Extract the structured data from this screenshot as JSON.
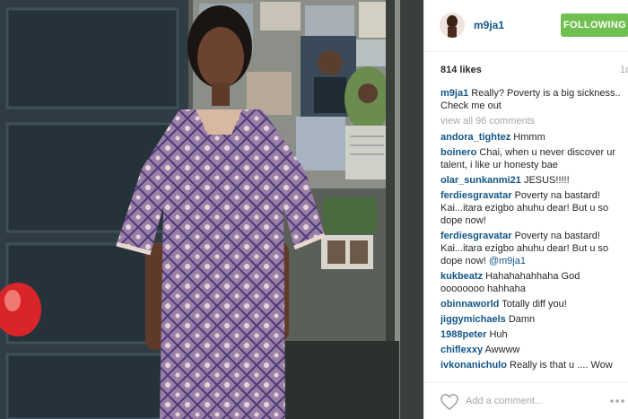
{
  "post": {
    "username": "m9ja1",
    "follow_label": "FOLLOWING",
    "likes": "814 likes",
    "time": "1d",
    "caption_user": "m9ja1",
    "caption_text": "Really? Poverty is a big sickness.. Check me out",
    "view_all": "view all 96 comments"
  },
  "comments": [
    {
      "user": "andora_tightez",
      "text": "Hmmm"
    },
    {
      "user": "boinero",
      "text": "Chai, when u never discover ur talent, i like ur honesty bae"
    },
    {
      "user": "olar_sunkanmi21",
      "text": "JESUS!!!!!"
    },
    {
      "user": "ferdiesgravatar",
      "text": "Poverty na bastard! Kai...itara ezigbo ahuhu dear! But u so dope now!"
    },
    {
      "user": "ferdiesgravatar",
      "text": "Poverty na bastard! Kai...itara ezigbo ahuhu dear! But u so dope now!",
      "mention": "@m9ja1"
    },
    {
      "user": "kukbeatz",
      "text": "Hahahahahhaha God oooooooo hahhaha"
    },
    {
      "user": "obinnaworld",
      "text": "Totally diff you!"
    },
    {
      "user": "jiggymichaels",
      "text": "Damn"
    },
    {
      "user": "1988peter",
      "text": "Huh"
    },
    {
      "user": "chiflexxy",
      "text": "Awwww"
    },
    {
      "user": "ivkonanichulo",
      "text": "Really is that u .... Wow"
    }
  ],
  "footer": {
    "add_comment_placeholder": "Add a comment...",
    "heart_icon": "heart-icon",
    "more_icon": "more-icon"
  },
  "colors": {
    "follow_green": "#70c050",
    "username_blue": "#125688",
    "muted_gray": "#a5a7aa"
  }
}
